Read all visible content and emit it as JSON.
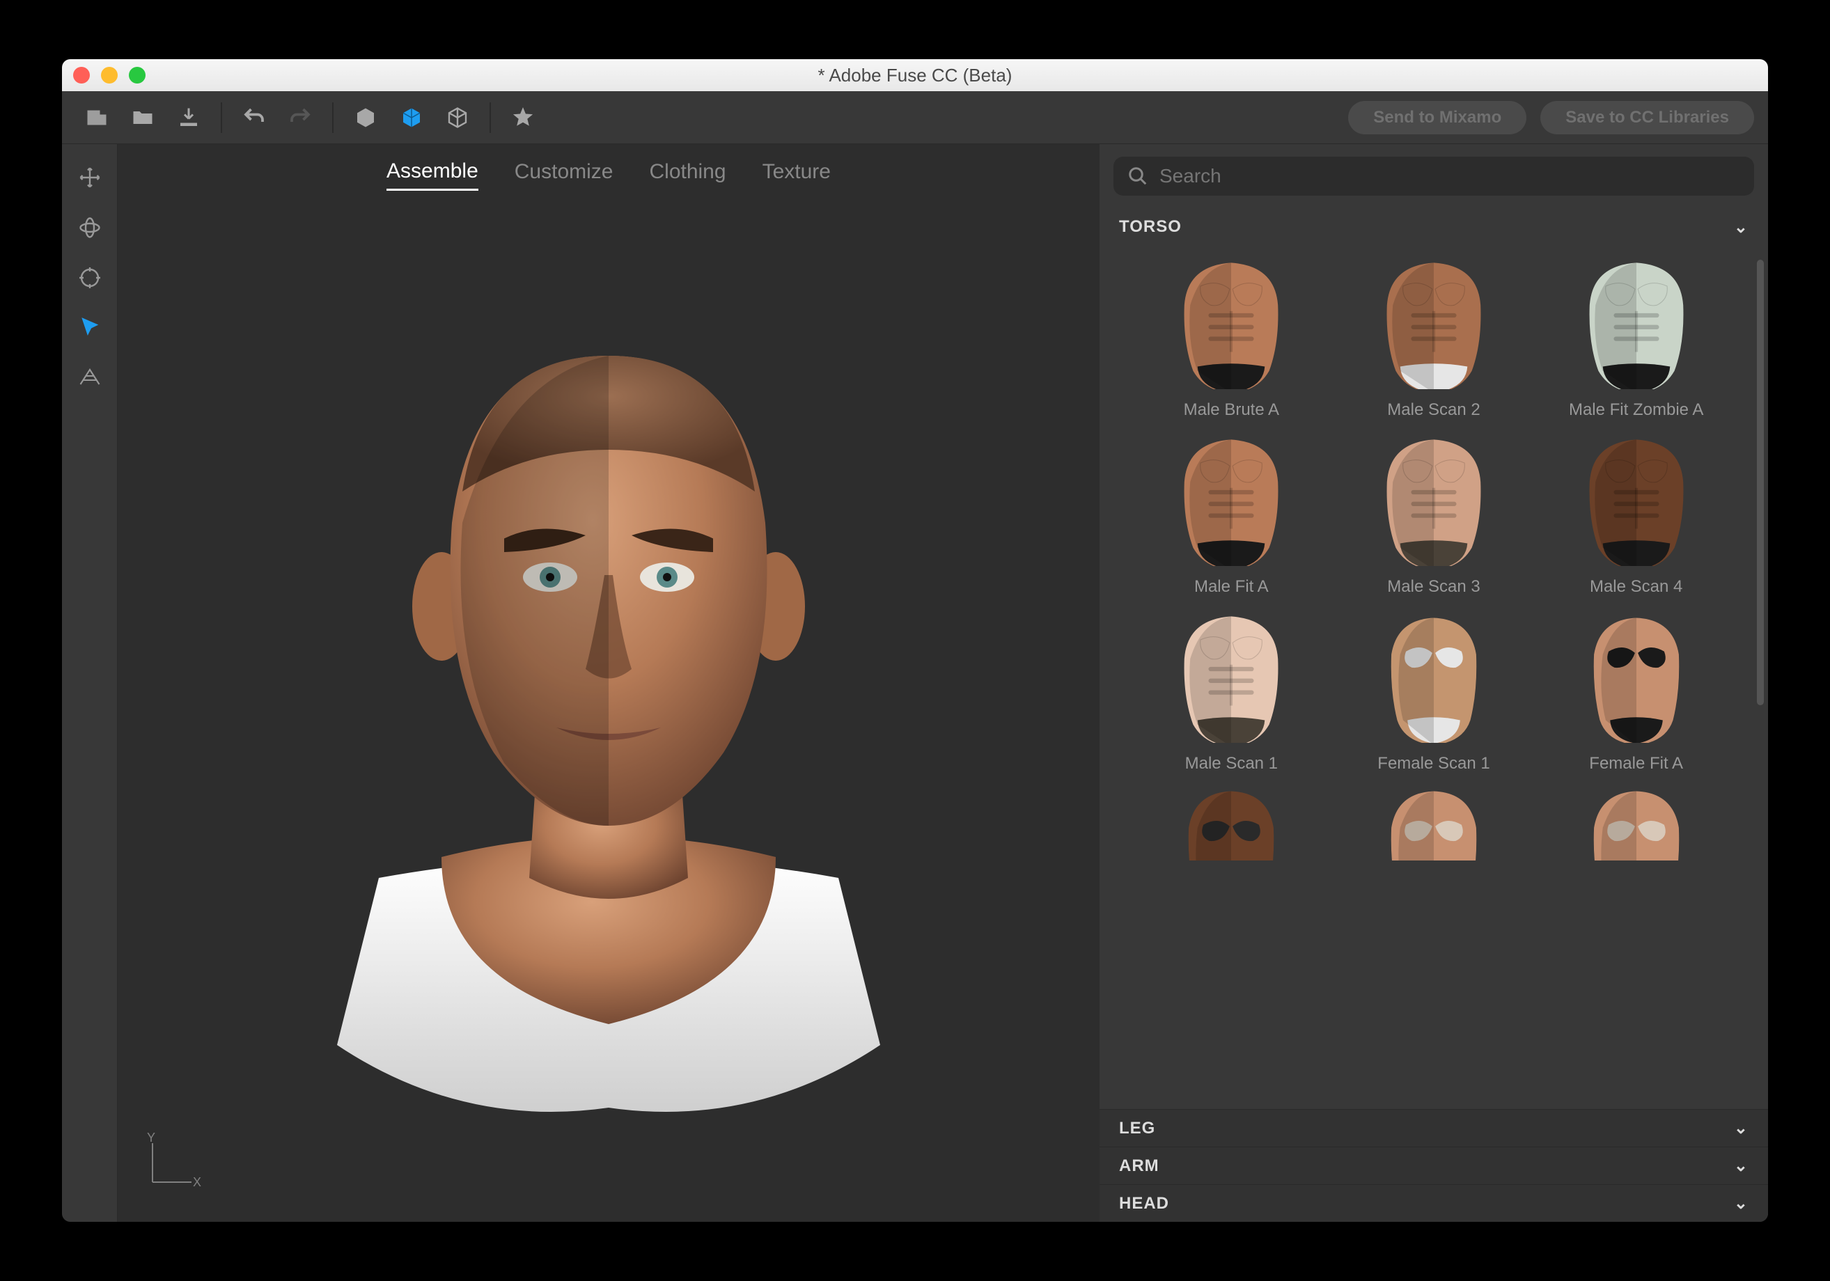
{
  "window": {
    "title": "* Adobe Fuse CC (Beta)"
  },
  "toolbar": {
    "send_label": "Send to Mixamo",
    "save_label": "Save to CC Libraries"
  },
  "tabs": [
    {
      "label": "Assemble",
      "active": true
    },
    {
      "label": "Customize"
    },
    {
      "label": "Clothing"
    },
    {
      "label": "Texture"
    }
  ],
  "search": {
    "placeholder": "Search"
  },
  "axis": {
    "x": "X",
    "y": "Y"
  },
  "sections": {
    "torso": {
      "label": "TORSO",
      "expanded": true
    },
    "leg": {
      "label": "LEG"
    },
    "arm": {
      "label": "ARM"
    },
    "head": {
      "label": "HEAD"
    }
  },
  "assets": [
    {
      "label": "Male Brute A",
      "skin": "#b97b58",
      "brief": "#1a1a1a"
    },
    {
      "label": "Male Scan 2",
      "skin": "#a96f4e",
      "brief": "#e6e6e6"
    },
    {
      "label": "Male Fit Zombie A",
      "skin": "#c9d4c8",
      "brief": "#1a1a1a"
    },
    {
      "label": "Male Fit A",
      "skin": "#b97b58",
      "brief": "#1a1a1a"
    },
    {
      "label": "Male Scan 3",
      "skin": "#d0a186",
      "brief": "#4a4238"
    },
    {
      "label": "Male Scan 4",
      "skin": "#6b4028",
      "brief": "#1a1a1a"
    },
    {
      "label": "Male Scan 1",
      "skin": "#e6c7b3",
      "brief": "#4a4238",
      "female": false
    },
    {
      "label": "Female Scan 1",
      "skin": "#c4956f",
      "brief": "#e6e6e6",
      "female": true
    },
    {
      "label": "Female Fit A",
      "skin": "#c79070",
      "brief": "#1a1a1a",
      "female": true
    },
    {
      "label": "",
      "skin": "#6b4028",
      "brief": "#2a2a2a",
      "female": true,
      "partial": true
    },
    {
      "label": "",
      "skin": "#c79070",
      "brief": "#d8c8b8",
      "female": true,
      "partial": true
    },
    {
      "label": "",
      "skin": "#c79070",
      "brief": "#d8c8b8",
      "female": true,
      "partial": true
    }
  ]
}
